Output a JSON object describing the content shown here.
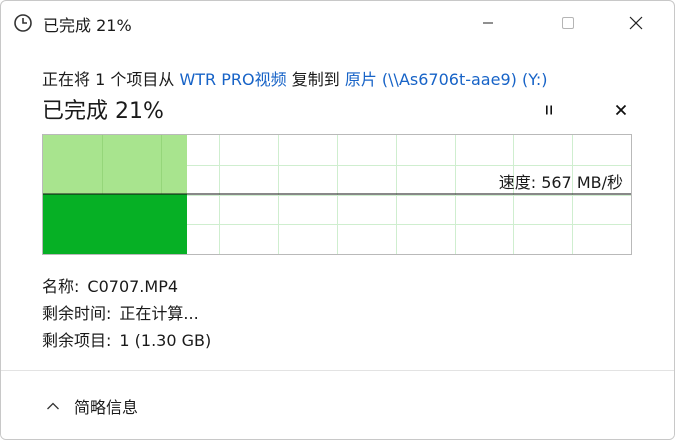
{
  "window": {
    "title": "已完成 21%",
    "icon": "clock-icon"
  },
  "transfer": {
    "prefix": "正在将 1 个项目从",
    "source": "WTR PRO视频",
    "middle": "复制到",
    "destination": "原片 (\\\\As6706t-aae9) (Y:)",
    "percent_text": "已完成 21%",
    "progress_fraction": 0.21,
    "pause_icon": "pause-icon",
    "cancel_icon": "close-icon"
  },
  "graph": {
    "speed_label": "速度: 567 MB/秒",
    "colors": {
      "fill_upper": "#a8e48e",
      "fill_lower": "#06b025",
      "grid": "#cfeecf"
    }
  },
  "details": [
    {
      "key": "名称:",
      "value": "C0707.MP4"
    },
    {
      "key": "剩余时间:",
      "value": "正在计算..."
    },
    {
      "key": "剩余项目:",
      "value": "1 (1.30 GB)"
    }
  ],
  "footer": {
    "toggle_label": "简略信息",
    "toggle_icon": "chevron-up-icon"
  }
}
